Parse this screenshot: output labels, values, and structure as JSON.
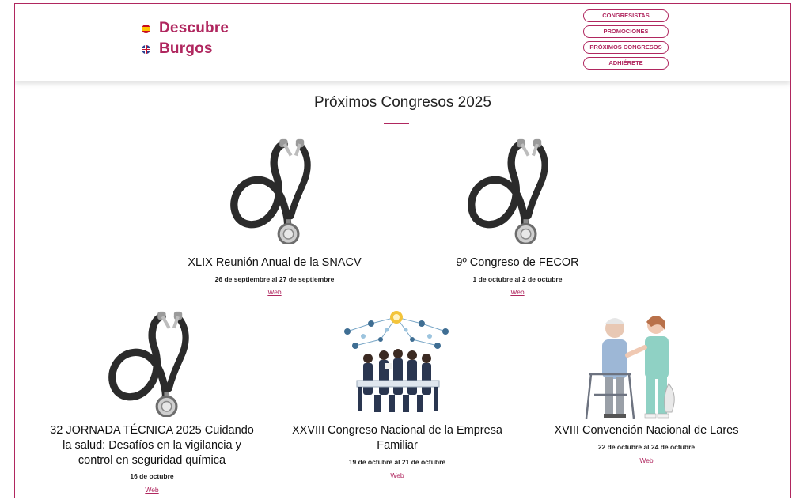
{
  "brand": {
    "line1": "Descubre",
    "line2": "Burgos"
  },
  "nav": {
    "items": [
      {
        "label": "CONGRESISTAS"
      },
      {
        "label": "PROMOCIONES"
      },
      {
        "label": "PRÓXIMOS CONGRESOS"
      },
      {
        "label": "ADHIÉRETE"
      }
    ]
  },
  "page": {
    "title": "Próximos Congresos 2025"
  },
  "congresses": [
    {
      "title": "XLIX Reunión Anual de la SNACV",
      "dates": "26 de septiembre al 27 de septiembre",
      "link": "Web",
      "image": "stethoscope"
    },
    {
      "title": "9º Congreso de FECOR",
      "dates": "1 de octubre al 2 de octubre",
      "link": "Web",
      "image": "stethoscope"
    },
    {
      "title": "32 JORNADA TÉCNICA 2025 Cuidando la salud: Desafíos en la vigilancia y control en seguridad química",
      "dates": "16 de octubre",
      "link": "Web",
      "image": "stethoscope"
    },
    {
      "title": "XXVIII Congreso Nacional de la Empresa Familiar",
      "dates": "19 de octubre al 21 de octubre",
      "link": "Web",
      "image": "business-meeting"
    },
    {
      "title": "XVIII Convención Nacional de Lares",
      "dates": "22 de octubre al 24 de octubre",
      "link": "Web",
      "image": "caregiver-elderly"
    }
  ],
  "colors": {
    "accent": "#b0275f"
  }
}
